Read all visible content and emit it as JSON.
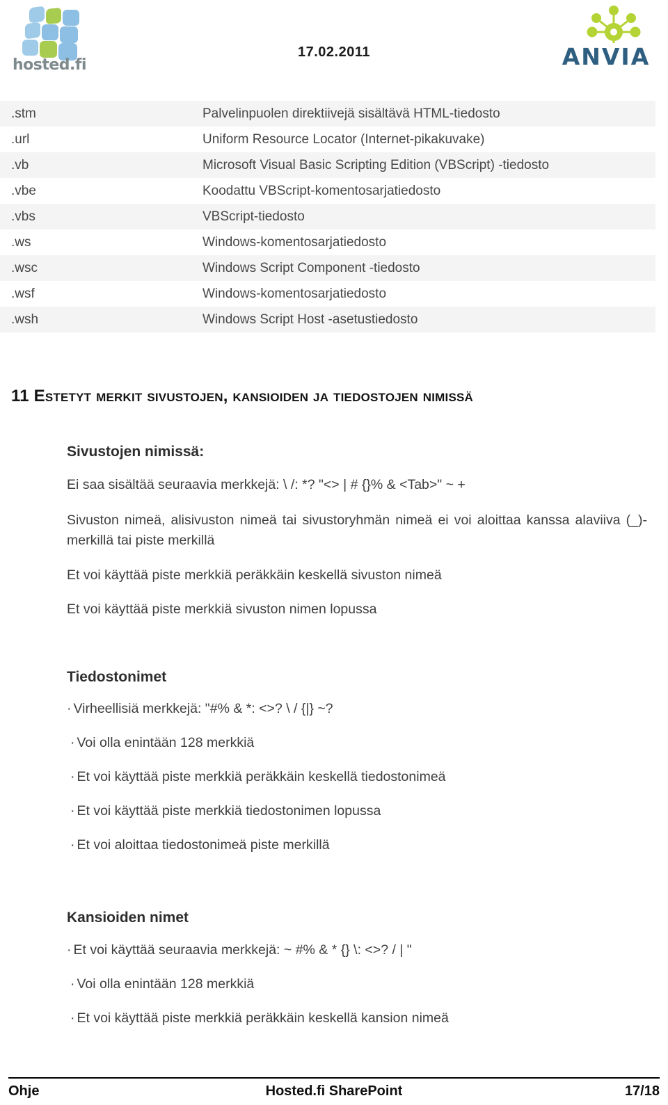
{
  "header": {
    "date": "17.02.2011",
    "left_logo": {
      "wordmark": "hosted.fi",
      "icon": "rounded-square-grid-icon",
      "colors": {
        "blue": "#8cbfe3",
        "green": "#a8cc4f",
        "text": "#7e8a8d"
      }
    },
    "right_logo": {
      "wordmark": "ANVIA",
      "icon": "molecule-node-icon",
      "colors": {
        "green": "#b4d334",
        "text": "#2e5f81"
      }
    }
  },
  "table": {
    "name": "file-extension-table",
    "rows": [
      {
        "ext": ".stm",
        "desc": "Palvelinpuolen direktiivejä sisältävä HTML-tiedosto"
      },
      {
        "ext": ".url",
        "desc": "Uniform Resource Locator (Internet-pikakuvake)"
      },
      {
        "ext": ".vb",
        "desc": "Microsoft Visual Basic Scripting Edition (VBScript) -tiedosto"
      },
      {
        "ext": ".vbe",
        "desc": "Koodattu VBScript-komentosarjatiedosto"
      },
      {
        "ext": ".vbs",
        "desc": "VBScript-tiedosto"
      },
      {
        "ext": ".ws",
        "desc": "Windows-komentosarjatiedosto"
      },
      {
        "ext": ".wsc",
        "desc": "Windows Script Component -tiedosto"
      },
      {
        "ext": ".wsf",
        "desc": "Windows-komentosarjatiedosto"
      },
      {
        "ext": ".wsh",
        "desc": "Windows Script Host -asetustiedosto"
      }
    ]
  },
  "chapter": {
    "number": "11",
    "title": "Estetyt merkit sivustojen, kansioiden ja tiedostojen nimissä"
  },
  "sections": {
    "sites": {
      "heading": "Sivustojen nimissä:",
      "line1": "Ei saa sisältää seuraavia merkkejä: \\ /: *? \"<> | # {}% & <Tab>\" ~ +",
      "line2": "Sivuston nimeä, alisivuston nimeä tai sivustoryhmän nimeä ei voi aloittaa kanssa alaviiva (_)- merkillä tai piste merkillä",
      "line3": "Et voi käyttää piste merkkiä peräkkäin keskellä sivuston nimeä",
      "line4": "Et voi käyttää piste merkkiä sivuston nimen lopussa"
    },
    "files": {
      "heading": "Tiedostonimet",
      "bullets": [
        "Virheellisiä merkkejä: \"#% & *: <>? \\ / {|} ~?",
        "Voi olla enintään 128 merkkiä",
        "Et voi käyttää piste merkkiä peräkkäin keskellä tiedostonimeä",
        "Et voi käyttää piste merkkiä tiedostonimen lopussa",
        "Et voi aloittaa tiedostonimeä piste merkillä"
      ]
    },
    "folders": {
      "heading": "Kansioiden nimet",
      "bullets": [
        "Et voi käyttää seuraavia merkkejä: ~ #% & * {} \\: <>? / | \"",
        "Voi olla enintään 128 merkkiä",
        "Et voi käyttää piste merkkiä peräkkäin keskellä kansion nimeä"
      ]
    }
  },
  "bullet_char": "·",
  "footer": {
    "left": "Ohje",
    "center": "Hosted.fi SharePoint",
    "right": "17/18"
  }
}
